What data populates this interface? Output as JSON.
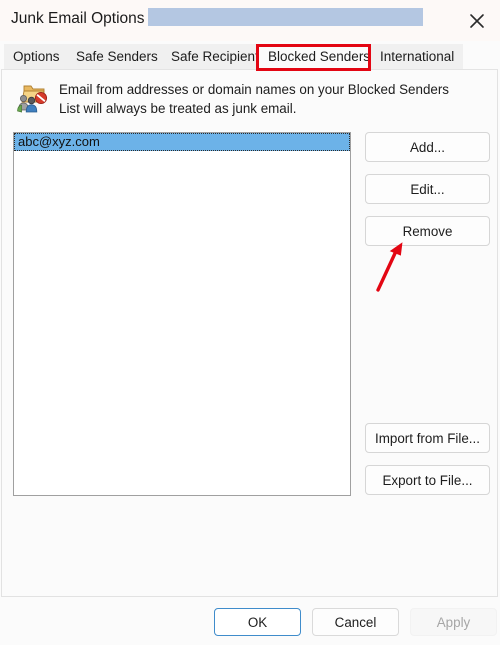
{
  "window": {
    "title": "Junk Email Options -",
    "title_redacted": true,
    "close_icon": "close-icon"
  },
  "tabs": [
    {
      "label": "Options",
      "active": false
    },
    {
      "label": "Safe Senders",
      "active": false
    },
    {
      "label": "Safe Recipients",
      "active": false
    },
    {
      "label": "Blocked Senders",
      "active": true
    },
    {
      "label": "International",
      "active": false
    }
  ],
  "info": {
    "icon": "blocked-senders-folder-icon",
    "text": "Email from addresses or domain names on your Blocked Senders List will always be treated as junk email."
  },
  "list": {
    "items": [
      {
        "value": "abc@xyz.com",
        "selected": true
      }
    ]
  },
  "side_buttons": {
    "add": "Add...",
    "edit": "Edit...",
    "remove": "Remove",
    "import": "Import from File...",
    "export": "Export to File..."
  },
  "bottom_buttons": {
    "ok": "OK",
    "cancel": "Cancel",
    "apply": "Apply",
    "apply_disabled": true,
    "ok_is_default": true
  },
  "annotations": {
    "highlight_rect_target": "Blocked Senders",
    "arrow_target": "Remove",
    "color": "#e30613"
  },
  "colors": {
    "accent_selection": "#6cb2e8",
    "redaction": "#b4c7e2",
    "annotation_red": "#e30613",
    "default_button_border": "#3f8ccb",
    "dialog_background": "#fbfbfb",
    "tab_inactive_background": "#f0f0f0"
  }
}
